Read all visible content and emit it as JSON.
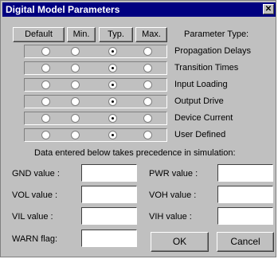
{
  "window": {
    "title": "Digital Model Parameters",
    "close_glyph": "✕"
  },
  "header_buttons": [
    "Default",
    "Min.",
    "Typ.",
    "Max."
  ],
  "param_type_label": "Parameter Type:",
  "rows": [
    {
      "label": "Propagation Delays",
      "selected": 2
    },
    {
      "label": "Transition Times",
      "selected": 2
    },
    {
      "label": "Input Loading",
      "selected": 2
    },
    {
      "label": "Output Drive",
      "selected": 2
    },
    {
      "label": "Device Current",
      "selected": 2
    },
    {
      "label": "User Defined",
      "selected": 2
    }
  ],
  "note": "Data entered below takes precedence in simulation:",
  "fields": {
    "gnd": {
      "label": "GND value :",
      "value": ""
    },
    "pwr": {
      "label": "PWR value :",
      "value": ""
    },
    "vol": {
      "label": "VOL value :",
      "value": ""
    },
    "voh": {
      "label": "VOH value :",
      "value": ""
    },
    "vil": {
      "label": "VIL value :",
      "value": ""
    },
    "vih": {
      "label": "VIH value :",
      "value": ""
    },
    "warn": {
      "label": "WARN flag:",
      "value": ""
    }
  },
  "buttons": {
    "ok": "OK",
    "cancel": "Cancel"
  }
}
